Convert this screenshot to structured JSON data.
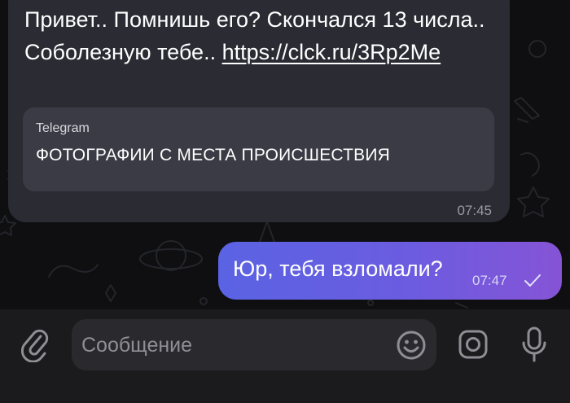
{
  "chat": {
    "incoming": {
      "text": "Привет.. Помнишь его? Скончался 13 числа.. Соболезную тебе.. ",
      "link": "https://clck.ru/3Rp2Me",
      "preview": {
        "site": "Telegram",
        "title": "ФОТОГРАФИИ С МЕСТА ПРОИСШЕСТВИЯ"
      },
      "time": "07:45"
    },
    "outgoing": {
      "text": "Юр, тебя взломали?",
      "time": "07:47",
      "status_icon": "check-icon"
    }
  },
  "composer": {
    "placeholder": "Сообщение",
    "icons": [
      "paperclip-icon",
      "emoji-icon",
      "camera-icon",
      "microphone-icon"
    ]
  },
  "colors": {
    "background": "#0c0c0d",
    "incoming_bubble": "#2a2b33",
    "link_preview": "#3a3b44",
    "outgoing_gradient_start": "#5a63e3",
    "outgoing_gradient_end": "#8654d6",
    "composer_bar": "#1b1b1e",
    "input_field": "#2a2a2e"
  }
}
